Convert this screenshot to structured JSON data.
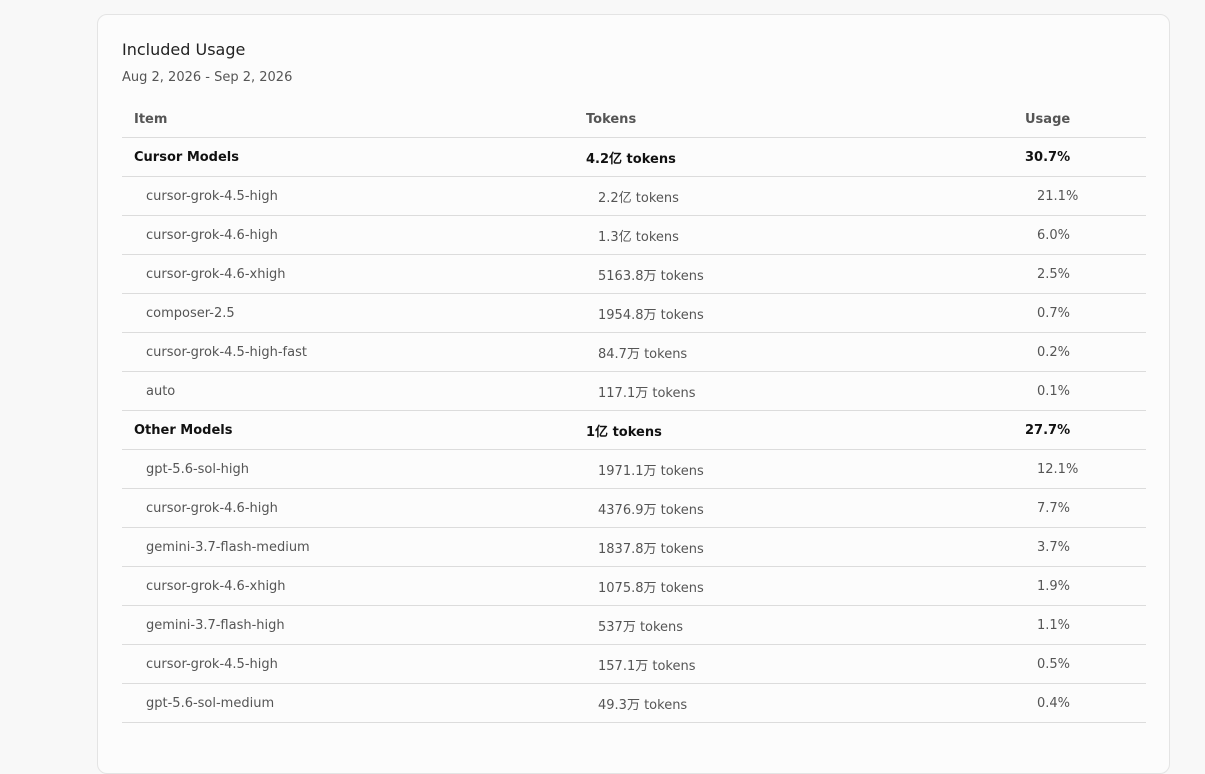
{
  "section": {
    "title": "Included Usage",
    "date_range": "Aug 2, 2026 - Sep 2, 2026"
  },
  "table": {
    "headers": {
      "item": "Item",
      "tokens": "Tokens",
      "usage": "Usage"
    },
    "groups": [
      {
        "name": "Cursor Models",
        "tokens": "4.2亿 tokens",
        "usage": "30.7%",
        "rows": [
          {
            "item": "cursor-grok-4.5-high",
            "tokens": "2.2亿 tokens",
            "usage": "21.1%"
          },
          {
            "item": "cursor-grok-4.6-high",
            "tokens": "1.3亿 tokens",
            "usage": "6.0%"
          },
          {
            "item": "cursor-grok-4.6-xhigh",
            "tokens": "5163.8万 tokens",
            "usage": "2.5%"
          },
          {
            "item": "composer-2.5",
            "tokens": "1954.8万 tokens",
            "usage": "0.7%"
          },
          {
            "item": "cursor-grok-4.5-high-fast",
            "tokens": "84.7万 tokens",
            "usage": "0.2%"
          },
          {
            "item": "auto",
            "tokens": "117.1万 tokens",
            "usage": "0.1%"
          }
        ]
      },
      {
        "name": "Other Models",
        "tokens": "1亿 tokens",
        "usage": "27.7%",
        "rows": [
          {
            "item": "gpt-5.6-sol-high",
            "tokens": "1971.1万 tokens",
            "usage": "12.1%"
          },
          {
            "item": "cursor-grok-4.6-high",
            "tokens": "4376.9万 tokens",
            "usage": "7.7%"
          },
          {
            "item": "gemini-3.7-flash-medium",
            "tokens": "1837.8万 tokens",
            "usage": "3.7%"
          },
          {
            "item": "cursor-grok-4.6-xhigh",
            "tokens": "1075.8万 tokens",
            "usage": "1.9%"
          },
          {
            "item": "gemini-3.7-flash-high",
            "tokens": "537万 tokens",
            "usage": "1.1%"
          },
          {
            "item": "cursor-grok-4.5-high",
            "tokens": "157.1万 tokens",
            "usage": "0.5%"
          },
          {
            "item": "gpt-5.6-sol-medium",
            "tokens": "49.3万 tokens",
            "usage": "0.4%"
          }
        ]
      }
    ]
  },
  "colors": {
    "background": "#f8f8f8",
    "card": "#fcfcfc",
    "border": "#dcdcdc",
    "text_primary": "#111111",
    "text_secondary": "#555555"
  }
}
